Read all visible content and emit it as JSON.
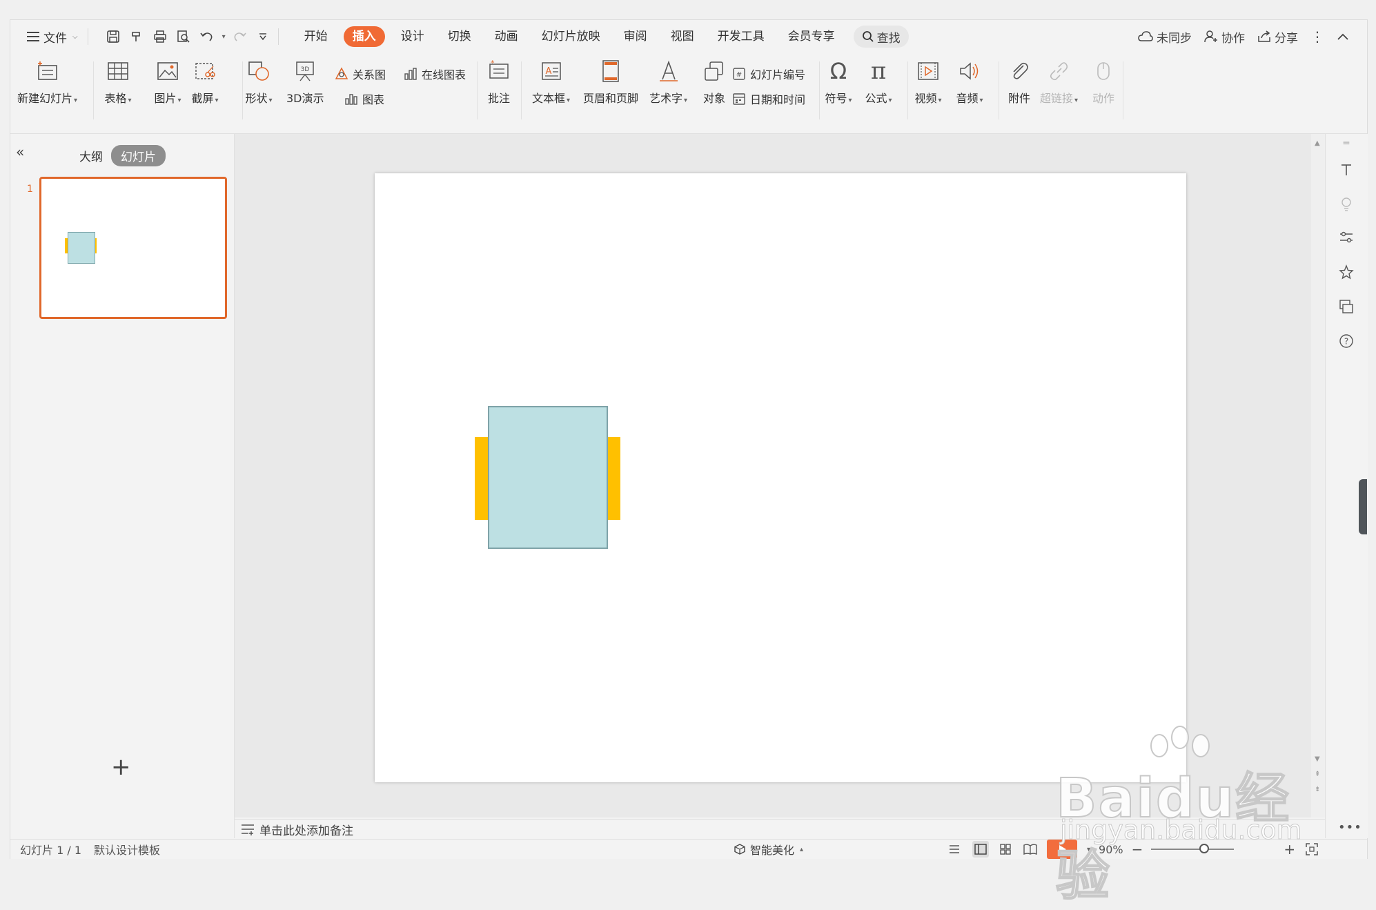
{
  "menu": {
    "file_label": "文件",
    "tabs": [
      {
        "label": "开始",
        "active": false
      },
      {
        "label": "插入",
        "active": true
      },
      {
        "label": "设计",
        "active": false
      },
      {
        "label": "切换",
        "active": false
      },
      {
        "label": "动画",
        "active": false
      },
      {
        "label": "幻灯片放映",
        "active": false
      },
      {
        "label": "审阅",
        "active": false
      },
      {
        "label": "视图",
        "active": false
      },
      {
        "label": "开发工具",
        "active": false
      },
      {
        "label": "会员专享",
        "active": false
      }
    ],
    "search_label": "查找",
    "sync_label": "未同步",
    "collab_label": "协作",
    "share_label": "分享"
  },
  "ribbon": {
    "new_slide": "新建幻灯片",
    "table": "表格",
    "picture": "图片",
    "screenshot": "截屏",
    "shape": "形状",
    "demo3d": "3D演示",
    "smartart": "关系图",
    "online_chart": "在线图表",
    "chart": "图表",
    "comment": "批注",
    "textbox": "文本框",
    "header_footer": "页眉和页脚",
    "wordart": "艺术字",
    "object": "对象",
    "slide_number": "幻灯片编号",
    "date_time": "日期和时间",
    "symbol": "符号",
    "formula": "公式",
    "video": "视频",
    "audio": "音频",
    "attachment": "附件",
    "hyperlink": "超链接",
    "action": "动作"
  },
  "left_panel": {
    "outline_tab": "大纲",
    "slides_tab": "幻灯片",
    "thumb_number": "1"
  },
  "notes": {
    "placeholder": "单击此处添加备注"
  },
  "status": {
    "slide_count": "幻灯片 1 / 1",
    "template": "默认设计模板",
    "beautify": "智能美化",
    "zoom": "90%"
  },
  "watermark": {
    "main": "Baidu经验",
    "sub": "jingyan.baidu.com"
  },
  "colors": {
    "accent": "#f06a35",
    "shape_fill": "#bde0e3",
    "bar_fill": "#ffc000"
  }
}
